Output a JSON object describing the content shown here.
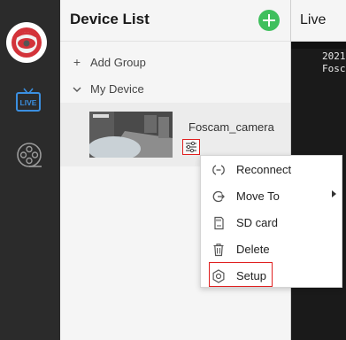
{
  "sidebar": {
    "logo_icon": "foscam-logo-icon",
    "live_icon_label": "LIVE",
    "playback_icon": "film-reel-icon"
  },
  "device_list": {
    "title": "Device List",
    "add_icon": "plus-circle-icon",
    "add_group_label": "Add Group",
    "my_device_label": "My Device",
    "device": {
      "name": "Foscam_camera",
      "settings_icon": "sliders-icon"
    }
  },
  "live": {
    "title": "Live",
    "osd_line1": "2021",
    "osd_line2": "Fosc"
  },
  "context_menu": {
    "items": [
      {
        "label": "Reconnect",
        "icon": "reconnect-icon"
      },
      {
        "label": "Move To",
        "icon": "move-to-icon",
        "has_submenu": true
      },
      {
        "label": "SD card",
        "icon": "sd-card-icon"
      },
      {
        "label": "Delete",
        "icon": "trash-icon"
      },
      {
        "label": "Setup",
        "icon": "gear-icon"
      }
    ]
  },
  "colors": {
    "rail_bg": "#2b2b2b",
    "accent_green": "#3fbf5d",
    "highlight_red": "#e02020",
    "live_blue": "#3b8fe0"
  }
}
